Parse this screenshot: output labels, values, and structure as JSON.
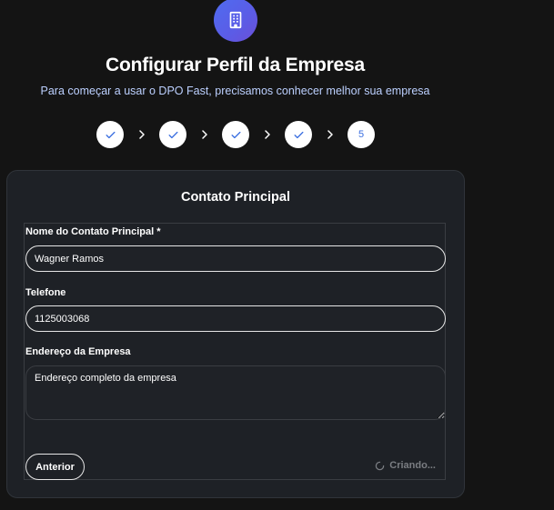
{
  "header": {
    "logo_icon": "building-icon",
    "title": "Configurar Perfil da Empresa",
    "subtitle": "Para começar a usar o DPO Fast, precisamos conhecer melhor sua empresa"
  },
  "stepper": {
    "steps": [
      {
        "state": "done",
        "icon": "check-icon"
      },
      {
        "state": "done",
        "icon": "check-icon"
      },
      {
        "state": "done",
        "icon": "check-icon"
      },
      {
        "state": "done",
        "icon": "check-icon"
      },
      {
        "state": "current",
        "label": "5"
      }
    ],
    "separator_icon": "chevron-right-icon"
  },
  "card": {
    "title": "Contato Principal",
    "fields": {
      "contact_name": {
        "label": "Nome do Contato Principal *",
        "value": "Wagner Ramos"
      },
      "phone": {
        "label": "Telefone",
        "value": "1125003068"
      },
      "address": {
        "label": "Endereço da Empresa",
        "placeholder": "Endereço completo da empresa",
        "value": ""
      }
    },
    "actions": {
      "previous_label": "Anterior",
      "create_label": "Criando...",
      "create_icon": "spinner-icon"
    }
  },
  "colors": {
    "background": "#141414",
    "card": "#1e2126",
    "accent": "#3b6fe0",
    "logo_gradient": [
      "#4f6cf0",
      "#6b4fd8"
    ]
  }
}
